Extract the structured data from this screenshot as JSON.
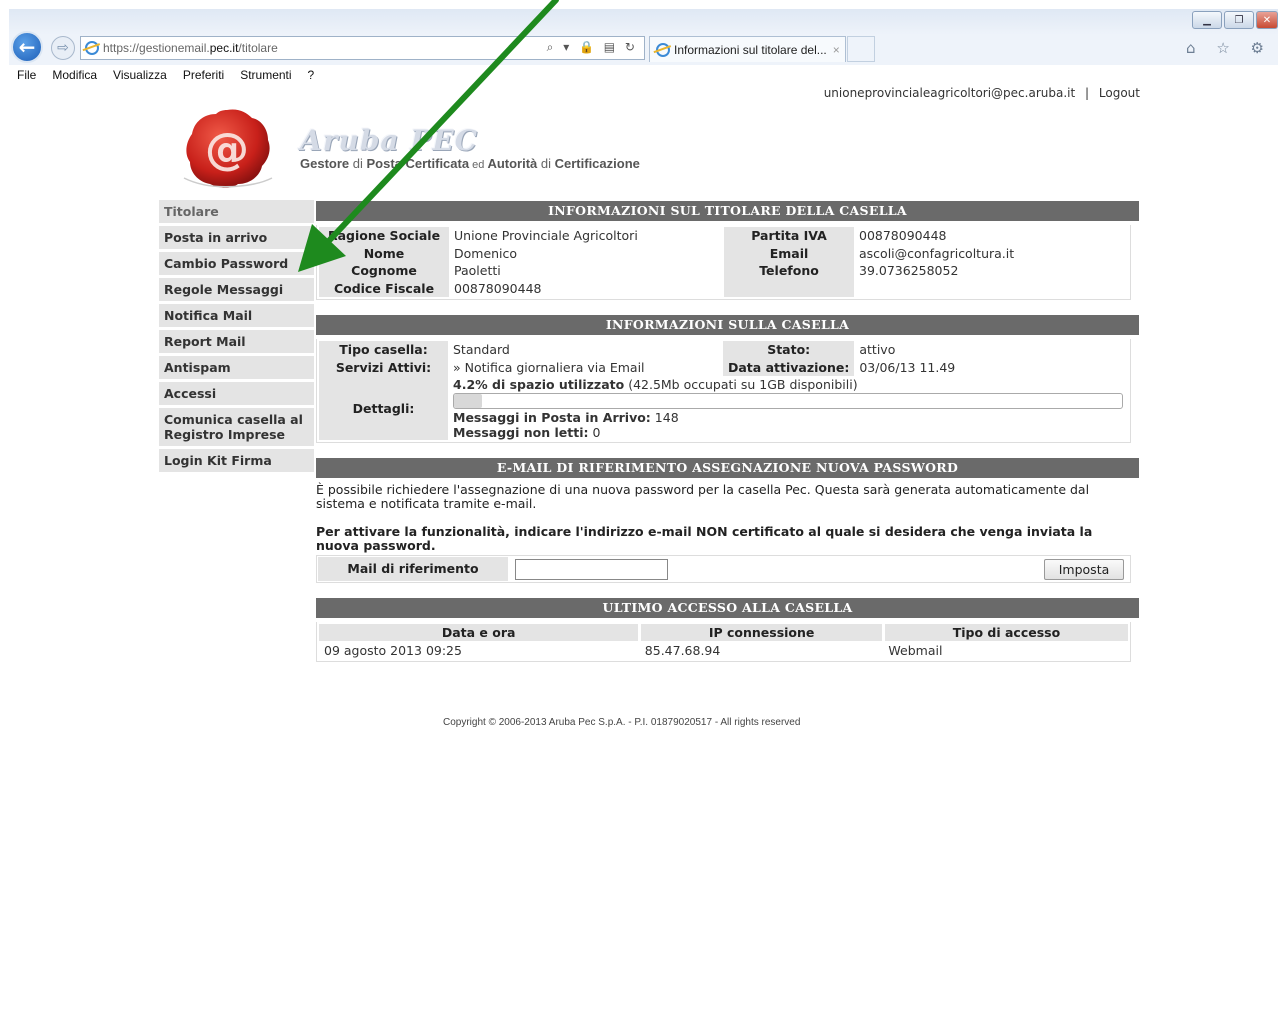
{
  "browser": {
    "url_prefix": "https://gestionemail.",
    "url_domain": "pec.it",
    "url_path": "/titolare",
    "address_tools": "⌕ ▾ 🔒 ▤ ↻",
    "tab_title": "Informazioni sul titolare del...",
    "tab_close": "×",
    "back_glyph": "←",
    "forward_glyph": "⇨",
    "right_icons": "⌂ ☆ ⚙",
    "window_buttons": {
      "minimize": "▁",
      "restore": "❐",
      "close": "✕"
    },
    "menu": [
      "File",
      "Modifica",
      "Visualizza",
      "Preferiti",
      "Strumenti",
      "?"
    ]
  },
  "userbar": {
    "email": "unioneprovincialeagricoltori@pec.aruba.it",
    "separator": "|",
    "logout": "Logout"
  },
  "logo": {
    "brand": "Aruba PEC",
    "tagline_parts": [
      "Gestore",
      " di ",
      "Posta Certificata",
      " ed ",
      "Autorità",
      " di ",
      "Certificazione"
    ]
  },
  "sidebar": {
    "items": [
      "Titolare",
      "Posta in arrivo",
      "Cambio Password",
      "Regole Messaggi",
      "Notifica Mail",
      "Report Mail",
      "Antispam",
      "Accessi",
      "Comunica casella al Registro Imprese",
      "Login Kit Firma"
    ]
  },
  "owner": {
    "header": "INFORMAZIONI SUL TITOLARE DELLA CASELLA",
    "ragione_label": "Ragione Sociale",
    "ragione_value": "Unione Provinciale Agricoltori",
    "nome_label": "Nome",
    "nome_value": "Domenico",
    "cognome_label": "Cognome",
    "cognome_value": "Paoletti",
    "cf_label": "Codice Fiscale",
    "cf_value": "00878090448",
    "piva_label": "Partita IVA",
    "piva_value": "00878090448",
    "email_label": "Email",
    "email_value": "ascoli@confagricoltura.it",
    "tel_label": "Telefono",
    "tel_value": "39.0736258052"
  },
  "mailbox": {
    "header": "INFORMAZIONI SULLA CASELLA",
    "tipo_label": "Tipo casella:",
    "tipo_value": "Standard",
    "servizi_label": "Servizi Attivi:",
    "servizi_value": "» Notifica giornaliera via Email",
    "stato_label": "Stato:",
    "stato_value": "attivo",
    "attivazione_label": "Data attivazione:",
    "attivazione_value": "03/06/13 11.49",
    "dettagli_label": "Dettagli:",
    "usage_bold": "4.2% di spazio utilizzato",
    "usage_detail": " (42.5Mb occupati su 1GB disponibili)",
    "usage_fraction": 0.042,
    "inbox_label": "Messaggi in Posta in Arrivo:",
    "inbox_value": " 148",
    "unread_label": "Messaggi non letti:",
    "unread_value": " 0"
  },
  "recovery": {
    "header": "E-MAIL DI RIFERIMENTO ASSEGNAZIONE NUOVA PASSWORD",
    "intro": "È possibile richiedere l'assegnazione di una nuova password per la casella Pec. Questa sarà generata automaticamente dal sistema e notificata tramite e-mail.",
    "instruction": "Per attivare la funzionalità, indicare l'indirizzo e-mail NON certificato al quale si desidera che venga inviata la nuova password.",
    "mail_label": "Mail di riferimento",
    "mail_value": "",
    "button": "Imposta"
  },
  "last_access": {
    "header": "ULTIMO ACCESSO ALLA CASELLA",
    "columns": [
      "Data e ora",
      "IP connessione",
      "Tipo di accesso"
    ],
    "row": [
      "09 agosto 2013 09:25",
      "85.47.68.94",
      "Webmail"
    ]
  },
  "footer": {
    "copyright": "Copyright © 2006-2013 Aruba Pec S.p.A. - P.I. 01879020517 - All rights reserved"
  },
  "colors": {
    "header_bg": "#6a6a6a",
    "label_bg": "#e4e4e4",
    "arrow": "#1e8a1e",
    "seal": "#c8201a"
  }
}
